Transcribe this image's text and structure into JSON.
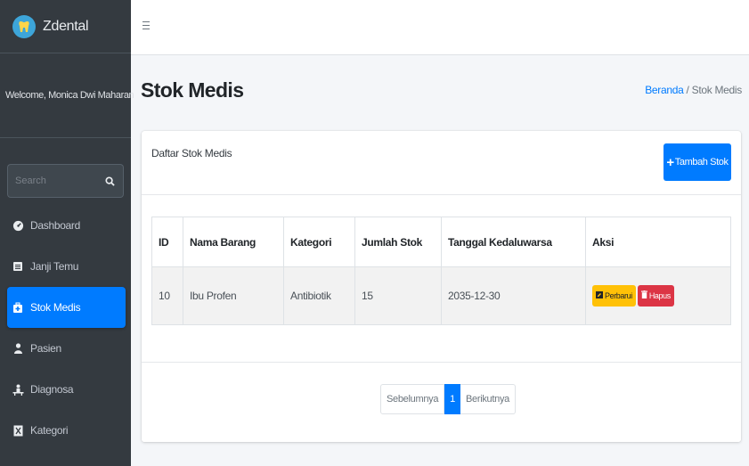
{
  "brand": {
    "name": "Zdental",
    "logo_icon": "tooth-icon"
  },
  "user": {
    "welcome": "Welcome, Monica Dwi Maharan"
  },
  "search": {
    "placeholder": "Search"
  },
  "sidebar": {
    "items": [
      {
        "label": "Dashboard",
        "icon": "dashboard-icon"
      },
      {
        "label": "Janji Temu",
        "icon": "calendar-icon"
      },
      {
        "label": "Stok Medis",
        "icon": "medkit-icon",
        "active": true
      },
      {
        "label": "Pasien",
        "icon": "user-icon"
      },
      {
        "label": "Diagnosa",
        "icon": "diagnosis-icon"
      },
      {
        "label": "Kategori",
        "icon": "category-icon"
      }
    ]
  },
  "page": {
    "title": "Stok Medis"
  },
  "breadcrumb": {
    "home": "Beranda",
    "separator": "/",
    "current": "Stok Medis"
  },
  "card": {
    "title": "Daftar Stok Medis",
    "add_button": {
      "plus": "+",
      "label": "Tambah Stok"
    }
  },
  "table": {
    "headers": [
      "ID",
      "Nama Barang",
      "Kategori",
      "Jumlah Stok",
      "Tanggal Kedaluwarsa",
      "Aksi"
    ],
    "rows": [
      {
        "id": "10",
        "nama": "Ibu Profen",
        "kategori": "Antibiotik",
        "jumlah": "15",
        "tanggal": "2035-12-30",
        "edit": "Perbarui",
        "delete": "Hapus"
      }
    ]
  },
  "pagination": {
    "prev": "Sebelumnya",
    "current": "1",
    "next": "Berikutnya"
  },
  "colors": {
    "primary": "#007bff",
    "sidebar": "#343a40",
    "warning": "#ffc107",
    "danger": "#dc3545"
  }
}
